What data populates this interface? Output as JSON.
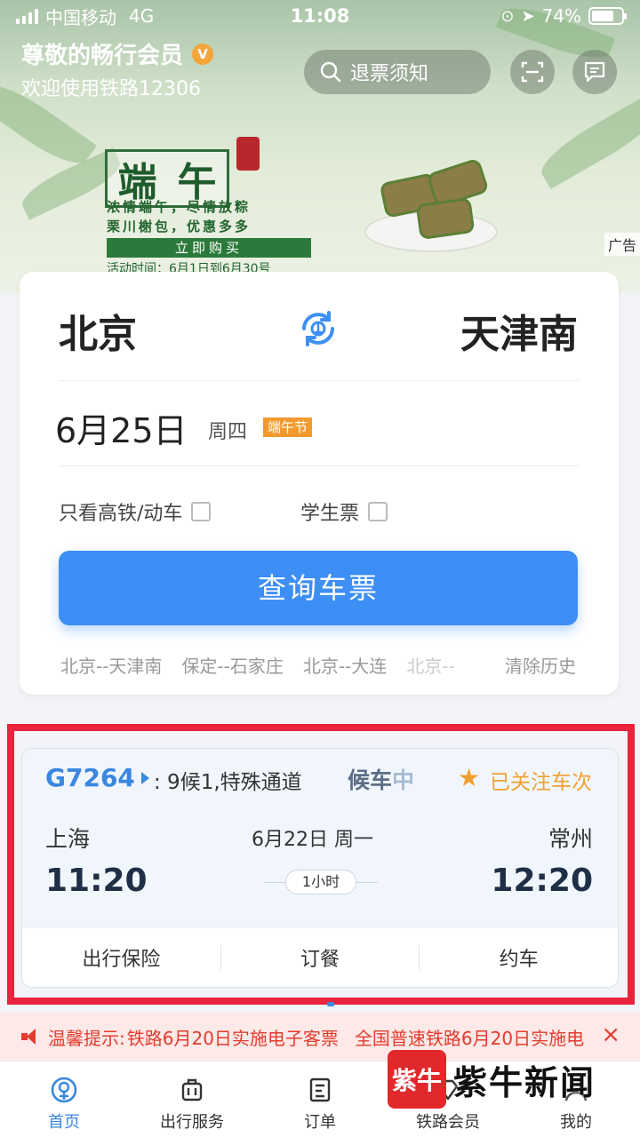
{
  "status_bar": {
    "carrier": "中国移动",
    "network": "4G",
    "time": "11:08",
    "battery": "74%",
    "battery_level": 0.74
  },
  "header": {
    "member_title": "尊敬的畅行会员",
    "member_badge": "V",
    "welcome": "欢迎使用铁路12306",
    "search_label": "退票须知",
    "icons": [
      "search-icon",
      "scan-icon",
      "message-icon"
    ]
  },
  "banner": {
    "title_chars": [
      "端",
      "午"
    ],
    "line1": "浓情端午，尽情放粽",
    "line2": "栗川榭包，优惠多多",
    "button": "立即购买",
    "period": "活动时间：6月1日到6月30号",
    "ad_tag": "广告"
  },
  "search_card": {
    "from_city": "北京",
    "to_city": "天津南",
    "date": "6月25日",
    "weekday": "周四",
    "holiday": "端午节",
    "option_highspeed": "只看高铁/动车",
    "option_student": "学生票",
    "query_button": "查询车票",
    "history": [
      "北京--天津南",
      "保定--石家庄",
      "北京--大连",
      "北京--"
    ],
    "clear_history": "清除历史",
    "accent_color": "#3d8ef5"
  },
  "trip": {
    "train_no": "G7264",
    "note": ": 9候1,特殊通道",
    "status_a": "候车",
    "status_b": "中",
    "follow": "已关注车次",
    "from_station": "上海",
    "to_station": "常州",
    "date": "6月22日 周一",
    "depart_time": "11:20",
    "arrive_time": "12:20",
    "duration": "1小时",
    "actions": [
      "出行保险",
      "订餐",
      "约车"
    ],
    "highlight_color": "#e8253c"
  },
  "notice": {
    "label": "温馨提示:",
    "text": "铁路6月20日实施电子客票",
    "text2": "全国普速铁路6月20日实施电",
    "close": "×"
  },
  "tabbar": [
    {
      "label": "首页",
      "icon": "railway-logo-icon",
      "active": true
    },
    {
      "label": "出行服务",
      "icon": "luggage-icon",
      "active": false
    },
    {
      "label": "订单",
      "icon": "order-list-icon",
      "active": false
    },
    {
      "label": "铁路会员",
      "icon": "member-diamond-icon",
      "active": false
    },
    {
      "label": "我的",
      "icon": "person-icon",
      "active": false
    }
  ],
  "watermark": {
    "logo": "紫牛",
    "text": "紫牛新闻"
  }
}
